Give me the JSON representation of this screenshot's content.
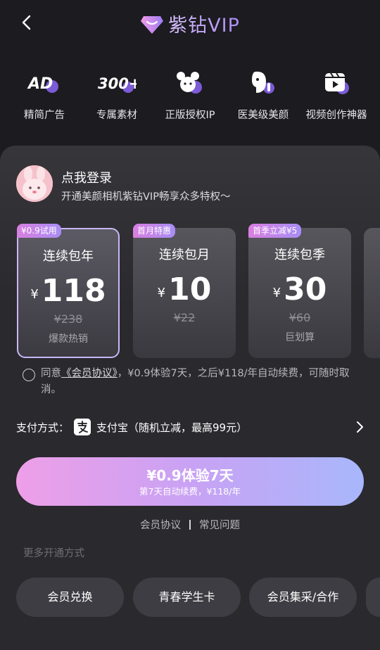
{
  "header": {
    "brand_title": "紫钻VIP",
    "back_icon": "chevron-left-icon"
  },
  "features": [
    {
      "label": "精简广告",
      "icon": "ad-free-icon",
      "icon_text": "AD"
    },
    {
      "label": "专属素材",
      "icon": "exclusive-material-icon",
      "icon_text": "300+"
    },
    {
      "label": "正版授权IP",
      "icon": "licensed-ip-icon"
    },
    {
      "label": "医美级美颜",
      "icon": "beauty-face-icon"
    },
    {
      "label": "视频创作神器",
      "icon": "video-creation-icon"
    }
  ],
  "login": {
    "title": "点我登录",
    "subtitle": "开通美颜相机紫钻VIP畅享众多特权～"
  },
  "plans": [
    {
      "tag": "¥0.9试用",
      "name": "连续包年",
      "currency": "¥",
      "price": "118",
      "original": "¥238",
      "note": "爆款热销",
      "selected": true
    },
    {
      "tag": "首月特惠",
      "name": "连续包月",
      "currency": "¥",
      "price": "10",
      "original": "¥22",
      "note": "",
      "selected": false
    },
    {
      "tag": "首季立减¥5",
      "name": "连续包季",
      "currency": "¥",
      "price": "30",
      "original": "¥60",
      "note": "巨划算",
      "selected": false
    }
  ],
  "agreement": {
    "prefix": "同意",
    "link": "《会员协议》",
    "suffix": "，¥0.9体验7天，之后¥118/年自动续费，可随时取消。"
  },
  "payment": {
    "label": "支付方式：",
    "method": "支付宝（随机立减，最高99元）",
    "icon": "alipay-icon"
  },
  "cta": {
    "title": "¥0.9体验7天",
    "subtitle": "第7天自动续费，¥118/年"
  },
  "links": {
    "member_agreement": "会员协议",
    "faq": "常见问题"
  },
  "more_methods": "更多开通方式",
  "chips": [
    "会员兑换",
    "青春学生卡",
    "会员集采/合作"
  ],
  "colors": {
    "accent_start": "#ee9fe7",
    "accent_end": "#a8b7fb",
    "background": "#1c1b20",
    "panel": "#2a292e"
  }
}
